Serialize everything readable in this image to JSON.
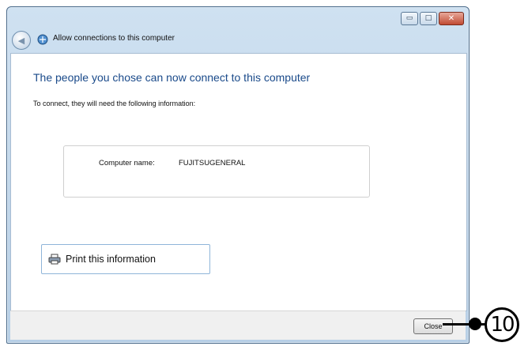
{
  "window": {
    "title": "Allow connections to this computer",
    "caption_buttons": {
      "minimize_icon": "minimize-icon",
      "maximize_icon": "maximize-icon",
      "close_icon": "close-icon",
      "minimize_glyph": "▭",
      "maximize_glyph": "□",
      "close_glyph": "✕"
    },
    "back_glyph": "◀"
  },
  "content": {
    "heading": "The people you chose can now connect to this computer",
    "subtext": "To connect, they will need the following information:",
    "info": {
      "label": "Computer name:",
      "value": "FUJITSUGENERAL"
    },
    "print_button": {
      "label": "Print this information",
      "icon": "printer-icon"
    }
  },
  "footer": {
    "close_label": "Close"
  },
  "callout": {
    "number": "10"
  },
  "colors": {
    "heading": "#1a4a8a",
    "frame": "#b7cfe6",
    "print_border": "#8fb5d9"
  }
}
